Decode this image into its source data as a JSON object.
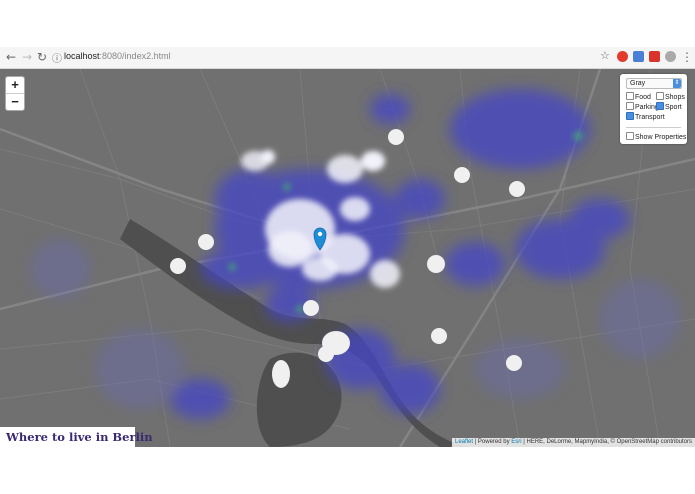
{
  "browser": {
    "back_icon": "arrow-left-icon",
    "forward_icon": "arrow-right-icon",
    "reload_icon": "reload-icon",
    "url_host": "localhost",
    "url_rest": ":8080/index2.html"
  },
  "map": {
    "zoom_in": "+",
    "zoom_out": "−",
    "basemap_select": "Gray",
    "layers": {
      "food": "Food",
      "shops": "Shops",
      "parking": "Parking",
      "sport": "Sport",
      "transport": "Transport",
      "show_properties": "Show Properties"
    },
    "layer_checked": {
      "food": false,
      "shops": false,
      "parking": false,
      "sport": true,
      "transport": true,
      "show_properties": false
    },
    "title": "Where to live in Berlin",
    "attribution": {
      "leaflet": "Leaflet",
      "powered_by": " | Powered by ",
      "esri": "Esri",
      "rest": " | HERE, DeLorme, MapmyIndia, © OpenStreetMap contributors"
    },
    "colors": {
      "heat": "#4a4ad8",
      "highlight": "#ffffff",
      "marker": "#1f8dd6"
    }
  }
}
